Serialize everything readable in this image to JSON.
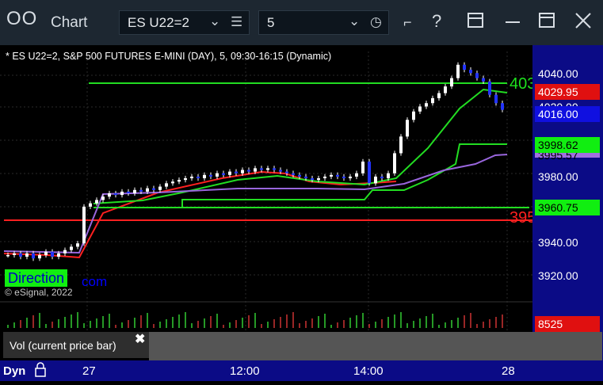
{
  "titlebar": {
    "logo": "OO",
    "title": "Chart",
    "symbol": "ES U22=2",
    "interval": "5",
    "colors": {
      "bg": "#1d2731",
      "text": "#d7dde3"
    }
  },
  "chart": {
    "info": "* ES U22=2, S&P 500 FUTURES E-MINI (DAY), 5, 09:30-16:15 (Dynamic)",
    "copyright": "© eSignal, 2022",
    "overlay_direction": "Direction",
    "overlay_com": "com",
    "level_green_label": "403",
    "level_red_label": "395",
    "price_axis_ticks": [
      "4040.00",
      "4020.00",
      "3980.00",
      "3940.00",
      "3920.00"
    ],
    "price_boxes": [
      {
        "label": "4029.95",
        "bg": "#e01010",
        "fg": "#ffffff"
      },
      {
        "label": "4016.00",
        "bg": "#1010e0",
        "fg": "#ffffff"
      },
      {
        "label": "3998.62",
        "bg": "#11ee11",
        "fg": "#000000"
      },
      {
        "label": "3995.57",
        "bg": "#a070e0",
        "fg": "#000000"
      },
      {
        "label": "3960.75",
        "bg": "#11ee11",
        "fg": "#000000"
      }
    ],
    "volume_value": "8525",
    "volume_panel_label": "Vol (current price bar)",
    "time_axis": [
      "27",
      "12:00",
      "14:00",
      "28"
    ],
    "bottom_left": "Dyn",
    "chart_data": {
      "type": "candlestick",
      "series": [
        {
          "name": "candles",
          "values": [
            3929,
            3930,
            3928,
            3930,
            3927,
            3929,
            3931,
            3928,
            3930,
            3932,
            3934,
            3936,
            3958,
            3960,
            3962,
            3964,
            3966,
            3965,
            3967,
            3966,
            3968,
            3967,
            3969,
            3968,
            3970,
            3972,
            3973,
            3974,
            3975,
            3976,
            3975,
            3977,
            3976,
            3978,
            3977,
            3979,
            3978,
            3980,
            3979,
            3981,
            3980,
            3981,
            3980,
            3979,
            3978,
            3977,
            3976,
            3975,
            3974,
            3975,
            3976,
            3977,
            3976,
            3975,
            3976,
            3978,
            3985,
            3972,
            3976,
            3975,
            3978,
            3990,
            4000,
            4010,
            4015,
            4018,
            4020,
            4023,
            4026,
            4030,
            4035,
            4043,
            4040,
            4038,
            4035,
            4033,
            4025,
            4020,
            4016
          ]
        }
      ],
      "ylim": [
        3910,
        4050
      ]
    }
  }
}
